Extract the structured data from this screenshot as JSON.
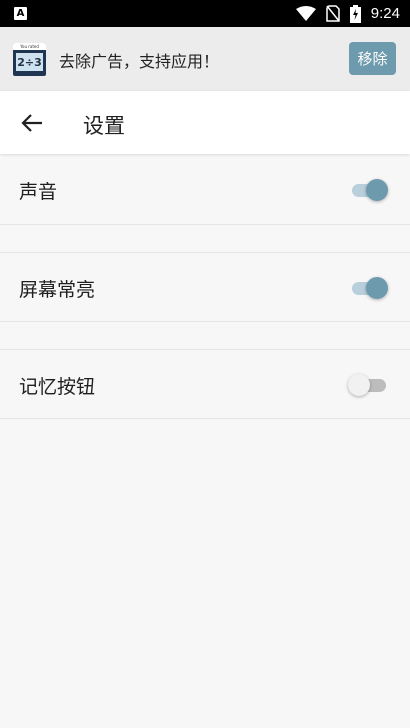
{
  "status_bar": {
    "app_icon_letter": "A",
    "time": "9:24"
  },
  "ad_banner": {
    "text": "去除广告，支持应用！",
    "remove_label": "移除",
    "thumb_strip": "You rated",
    "thumb_screen": "2÷3"
  },
  "toolbar": {
    "title": "设置"
  },
  "settings": [
    {
      "label": "声音",
      "on": true
    },
    {
      "label": "屏幕常亮",
      "on": true
    },
    {
      "label": "记忆按钮",
      "on": false
    }
  ],
  "colors": {
    "accent": "#6e9aad",
    "accent_track": "#b9cfdb"
  }
}
